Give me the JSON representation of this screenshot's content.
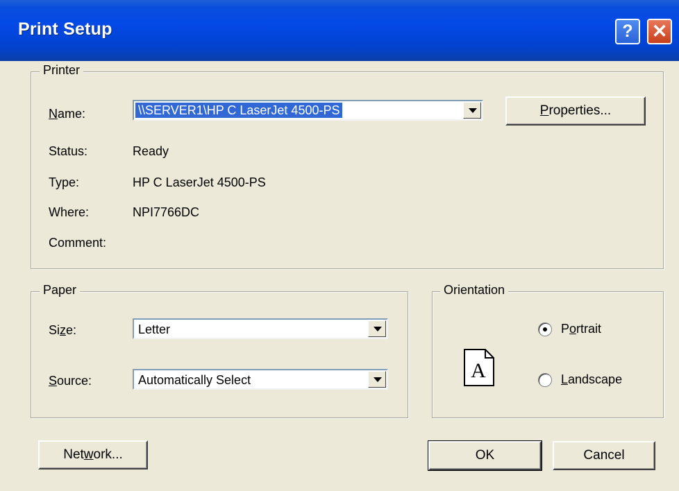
{
  "window": {
    "title": "Print Setup",
    "help_glyph": "?",
    "close_glyph": "✕"
  },
  "printer": {
    "legend": "Printer",
    "name_label": "Name:",
    "name_value": "\\\\SERVER1\\HP C LaserJet 4500-PS",
    "properties_button": "Properties...",
    "status_label": "Status:",
    "status_value": "Ready",
    "type_label": "Type:",
    "type_value": "HP C LaserJet 4500-PS",
    "where_label": "Where:",
    "where_value": "NPI7766DC",
    "comment_label": "Comment:"
  },
  "paper": {
    "legend": "Paper",
    "size_label": "Size:",
    "size_value": "Letter",
    "source_label": "Source:",
    "source_value": "Automatically Select"
  },
  "orientation": {
    "legend": "Orientation",
    "page_icon_glyph": "A",
    "options": [
      {
        "label": "Portrait",
        "checked": true
      },
      {
        "label": "Landscape",
        "checked": false
      }
    ]
  },
  "buttons": {
    "network": "Network...",
    "ok": "OK",
    "cancel": "Cancel"
  },
  "colors": {
    "titlebar": "#0349e6",
    "dialog_bg": "#ece9d8",
    "selection": "#3168d5"
  }
}
